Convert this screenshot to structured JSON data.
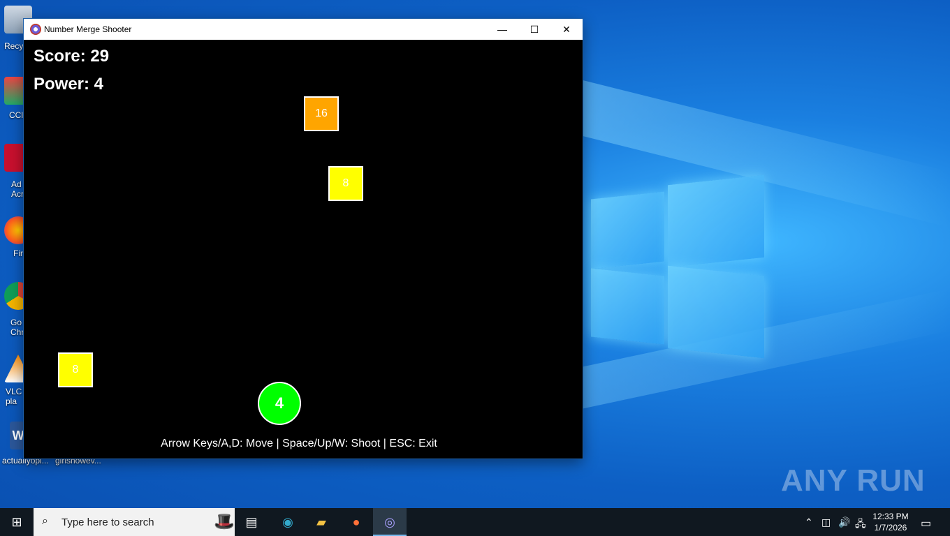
{
  "desktop": {
    "icons": [
      {
        "label": "Recy",
        "icon": "recycle-bin-icon"
      },
      {
        "label": "CCl",
        "icon": "ccleaner-icon"
      },
      {
        "label": "Ad Acr",
        "icon": "adobe-acrobat-icon"
      },
      {
        "label": "Fir",
        "icon": "firefox-icon"
      },
      {
        "label": "Go Chr",
        "icon": "chrome-icon"
      },
      {
        "label": "VLC pla",
        "icon": "vlc-icon"
      },
      {
        "label": "actuallyopi...",
        "icon": "word-document-icon"
      },
      {
        "label": "girlshowev...",
        "icon": "document-icon"
      }
    ],
    "watermark": "ANY RUN"
  },
  "window": {
    "title": "Number Merge Shooter",
    "controls": {
      "minimize": "—",
      "maximize": "☐",
      "close": "✕"
    }
  },
  "game": {
    "score_text": "Score: 29",
    "power_text": "Power: 4",
    "blocks": [
      {
        "value": "16",
        "color": "#ffa500"
      },
      {
        "value": "8",
        "color": "#ffff00"
      },
      {
        "value": "8",
        "color": "#ffff00"
      }
    ],
    "player": {
      "value": "4",
      "color": "#00ff00"
    },
    "help_text": "Arrow Keys/A,D: Move | Space/Up/W: Shoot | ESC: Exit"
  },
  "taskbar": {
    "search_placeholder": "Type here to search",
    "apps": [
      "task-view-icon",
      "edge-icon",
      "file-explorer-icon",
      "firefox-icon",
      "number-merge-shooter-icon"
    ],
    "clock": {
      "time": "12:33 PM",
      "date": "1/7/2026"
    }
  }
}
